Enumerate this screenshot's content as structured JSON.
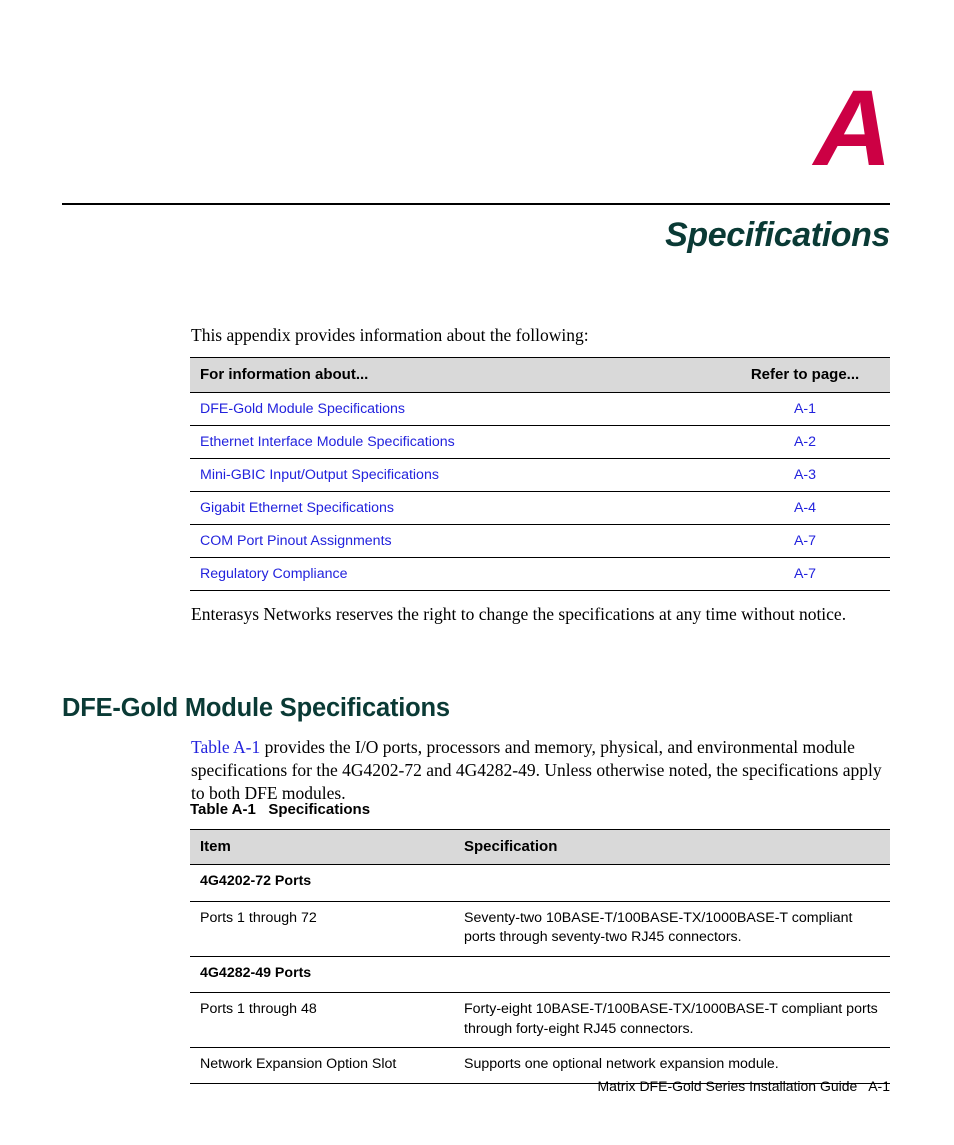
{
  "appendix": {
    "letter": "A",
    "title": "Specifications",
    "letter_color": "#CC0044",
    "title_color": "#0A3A35"
  },
  "intro": {
    "text": "This appendix provides information about the following:"
  },
  "toc": {
    "headers": {
      "topic": "For information about...",
      "page": "Refer to page..."
    },
    "rows": [
      {
        "topic": "DFE-Gold Module Specifications",
        "page": "A-1"
      },
      {
        "topic": "Ethernet Interface Module Specifications",
        "page": "A-2"
      },
      {
        "topic": "Mini-GBIC Input/Output Specifications",
        "page": "A-3"
      },
      {
        "topic": "Gigabit Ethernet Specifications",
        "page": "A-4"
      },
      {
        "topic": "COM Port Pinout Assignments",
        "page": "A-7"
      },
      {
        "topic": "Regulatory Compliance",
        "page": "A-7"
      }
    ],
    "link_color": "#2222DD",
    "header_bg": "#D9D9D9"
  },
  "notice": {
    "text": "Enterasys Networks reserves the right to change the specifications at any time without notice."
  },
  "section": {
    "heading": "DFE-Gold Module Specifications",
    "para_link": "Table A-1",
    "para_rest": " provides the I/O ports, processors and memory, physical, and environmental module specifications for the 4G4202-72 and 4G4282-49. Unless otherwise noted, the specifications apply to both DFE modules."
  },
  "spec_table": {
    "caption": "Table A-1   Specifications",
    "headers": {
      "item": "Item",
      "specification": "Specification"
    },
    "rows": [
      {
        "kind": "group",
        "item": "4G4202-72 Ports",
        "specification": ""
      },
      {
        "kind": "data",
        "item": "Ports 1 through 72",
        "specification": "Seventy-two 10BASE-T/100BASE-TX/1000BASE-T compliant ports through seventy-two RJ45 connectors."
      },
      {
        "kind": "group",
        "item": "4G4282-49 Ports",
        "specification": ""
      },
      {
        "kind": "data",
        "item": "Ports 1 through 48",
        "specification": "Forty-eight 10BASE-T/100BASE-TX/1000BASE-T compliant ports through forty-eight RJ45 connectors."
      },
      {
        "kind": "data",
        "item": "Network Expansion Option Slot",
        "specification": "Supports one optional network expansion module."
      }
    ]
  },
  "footer": {
    "text": "Matrix DFE-Gold Series Installation Guide   A-1"
  }
}
